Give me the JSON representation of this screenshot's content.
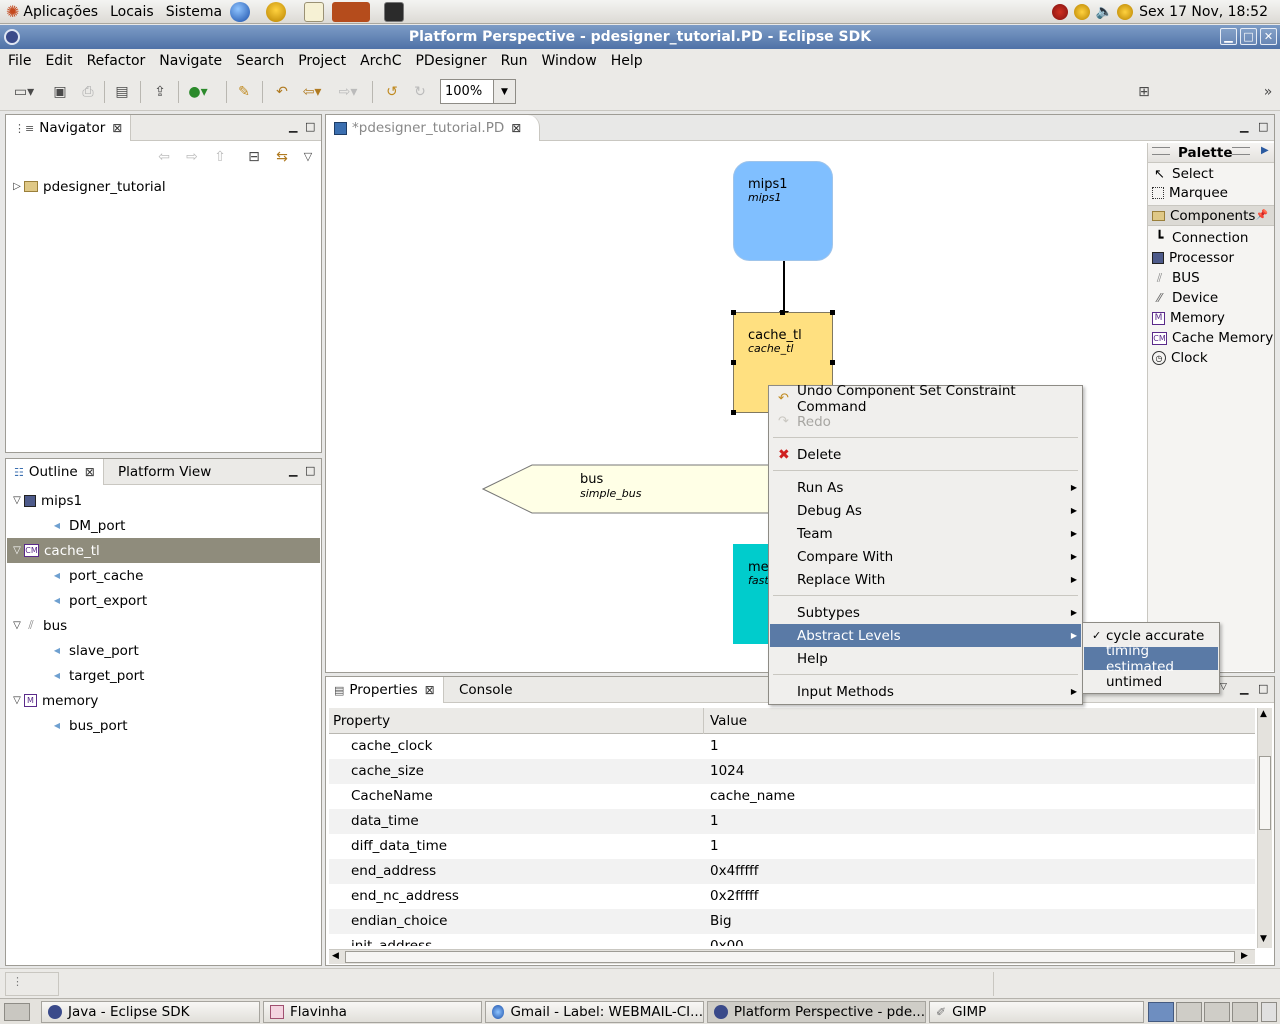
{
  "gnome_panel": {
    "menus": [
      "Aplicações",
      "Locais",
      "Sistema"
    ],
    "clock": "Sex 17 Nov, 18:52"
  },
  "window": {
    "title": "Platform Perspective - pdesigner_tutorial.PD - Eclipse SDK"
  },
  "menubar": [
    "File",
    "Edit",
    "Refactor",
    "Navigate",
    "Search",
    "Project",
    "ArchC",
    "PDesigner",
    "Run",
    "Window",
    "Help"
  ],
  "toolbar": {
    "zoom": "100%"
  },
  "navigator": {
    "tab": "Navigator",
    "items": [
      {
        "label": "pdesigner_tutorial"
      }
    ]
  },
  "outline": {
    "tabs": [
      "Outline",
      "Platform View"
    ],
    "tree": [
      {
        "label": "mips1",
        "level": 0
      },
      {
        "label": "DM_port",
        "level": 1
      },
      {
        "label": "cache_tl",
        "level": 0
      },
      {
        "label": "port_cache",
        "level": 1
      },
      {
        "label": "port_export",
        "level": 1
      },
      {
        "label": "bus",
        "level": 0
      },
      {
        "label": "slave_port",
        "level": 1
      },
      {
        "label": "target_port",
        "level": 1
      },
      {
        "label": "memory",
        "level": 0
      },
      {
        "label": "bus_port",
        "level": 1
      }
    ]
  },
  "editor": {
    "tab": "*pdesigner_tutorial.PD",
    "nodes": {
      "mips1": {
        "name": "mips1",
        "type": "mips1",
        "color": "#80bfff"
      },
      "cache": {
        "name": "cache_tl",
        "type": "cache_tl",
        "color": "#ffe080"
      },
      "bus": {
        "name": "bus",
        "type": "simple_bus",
        "color": "#ffffe6"
      },
      "memory": {
        "name": "me",
        "type": "fast",
        "color": "#00cccc"
      }
    }
  },
  "palette": {
    "title": "Palette",
    "tools": [
      "Select",
      "Marquee"
    ],
    "drawer": "Components",
    "items": [
      "Connection",
      "Processor",
      "BUS",
      "Device",
      "Memory",
      "Cache Memory",
      "Clock"
    ]
  },
  "properties": {
    "tabs": [
      "Properties",
      "Console"
    ],
    "headers": [
      "Property",
      "Value"
    ],
    "rows": [
      {
        "name": "cache_clock",
        "value": "1"
      },
      {
        "name": "cache_size",
        "value": "1024"
      },
      {
        "name": "CacheName",
        "value": "cache_name"
      },
      {
        "name": "data_time",
        "value": "1"
      },
      {
        "name": "diff_data_time",
        "value": "1"
      },
      {
        "name": "end_address",
        "value": "0x4fffff"
      },
      {
        "name": "end_nc_address",
        "value": "0x2fffff"
      },
      {
        "name": "endian_choice",
        "value": "Big"
      },
      {
        "name": "init_address",
        "value": "0x00"
      }
    ]
  },
  "context_menu": {
    "items": [
      {
        "label": "Undo Component Set Constraint Command",
        "icon": "undo-icon"
      },
      {
        "label": "Redo",
        "disabled": true
      },
      {
        "label": "Delete",
        "icon": "delete-icon"
      },
      {
        "label": "Run As",
        "submenu": true
      },
      {
        "label": "Debug As",
        "submenu": true
      },
      {
        "label": "Team",
        "submenu": true
      },
      {
        "label": "Compare With",
        "submenu": true
      },
      {
        "label": "Replace With",
        "submenu": true
      },
      {
        "label": "Subtypes",
        "submenu": true
      },
      {
        "label": "Abstract Levels",
        "submenu": true,
        "selected": true
      },
      {
        "label": "Help"
      },
      {
        "label": "Input Methods",
        "submenu": true
      }
    ],
    "submenu": [
      {
        "label": "cycle accurate",
        "checked": true
      },
      {
        "label": "timing estimated",
        "selected": true
      },
      {
        "label": "untimed"
      }
    ]
  },
  "taskbar": [
    {
      "label": "Java - Eclipse SDK"
    },
    {
      "label": "Flavinha"
    },
    {
      "label": "Gmail - Label: WEBMAIL-CI..."
    },
    {
      "label": "Platform Perspective - pde...",
      "active": true
    },
    {
      "label": "GIMP"
    }
  ]
}
